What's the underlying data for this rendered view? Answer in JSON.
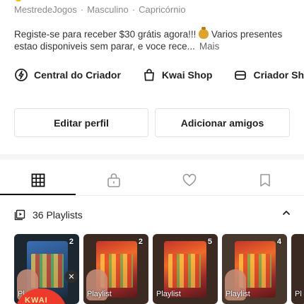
{
  "profile": {
    "meta": [
      "MestredeJogos",
      "Masculino",
      "Capricórnio"
    ],
    "separator": "·",
    "bio_text": "Registe-se para receber $30 grátis agora!!! ",
    "bio_icon": "money-bag-icon",
    "bio_text_2": " Varios presentes estao disponiveis sem parar, e voce rece...",
    "bio_more": "Mais"
  },
  "quick_links": [
    {
      "label": "Central do Criador",
      "icon": "creator-center-icon"
    },
    {
      "label": "Kwai Shop",
      "icon": "shopping-bag-icon"
    },
    {
      "label": "Criador Sho",
      "icon": "creator-shop-icon"
    }
  ],
  "actions": {
    "edit_profile": "Editar perfil",
    "add_friends": "Adicionar amigos"
  },
  "tabs": [
    {
      "name": "grid",
      "icon": "grid-icon",
      "active": true
    },
    {
      "name": "private",
      "icon": "lock-icon",
      "active": false
    },
    {
      "name": "liked",
      "icon": "heart-icon",
      "active": false
    },
    {
      "name": "saved",
      "icon": "bookmark-icon",
      "active": false
    }
  ],
  "playlists": {
    "title": "36 Playlists",
    "icon": "playlist-icon",
    "toggle_icon": "chevron-up-icon",
    "items": [
      {
        "label": "Pl",
        "count": "2"
      },
      {
        "label": "Playlist",
        "count": "2"
      },
      {
        "label": "Playlist",
        "count": "5"
      },
      {
        "label": "Playlist",
        "count": "4"
      },
      {
        "label": "Pl",
        "count": ""
      }
    ]
  },
  "badge": {
    "text": "KWAI"
  },
  "colors": {
    "accent": "#ee3a2b",
    "text": "#222222",
    "muted": "#8a8a8a",
    "border": "#e2e2e2"
  }
}
